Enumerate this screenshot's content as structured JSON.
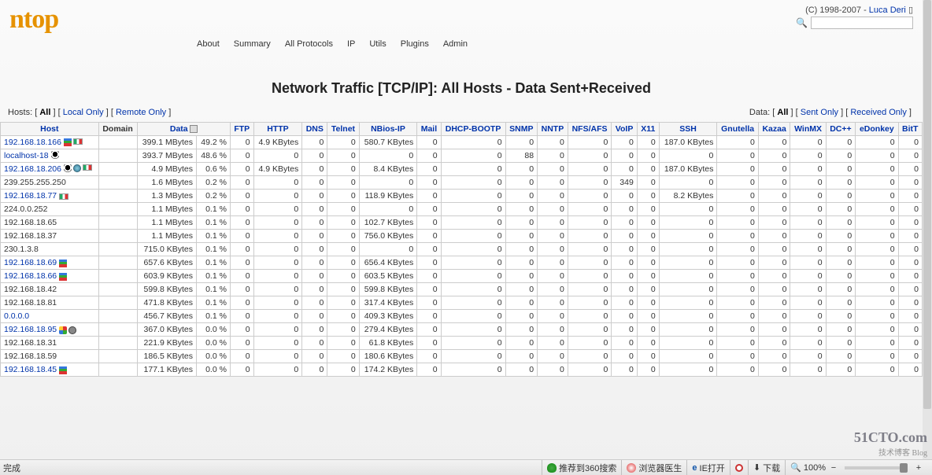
{
  "logo": "ntop",
  "copyright_prefix": "(C) 1998-2007 - ",
  "copyright_author": "Luca Deri",
  "search": {
    "placeholder": ""
  },
  "menu": [
    "About",
    "Summary",
    "All Protocols",
    "IP",
    "Utils",
    "Plugins",
    "Admin"
  ],
  "page_title": "Network Traffic [TCP/IP]: All Hosts - Data Sent+Received",
  "hosts_filter": {
    "label": "Hosts:",
    "all": "All",
    "local": "Local Only",
    "remote": "Remote Only"
  },
  "data_filter": {
    "label": "Data:",
    "all": "All",
    "sent": "Sent Only",
    "recv": "Received Only"
  },
  "columns": [
    "Host",
    "Domain",
    "Data",
    "FTP",
    "HTTP",
    "DNS",
    "Telnet",
    "NBios-IP",
    "Mail",
    "DHCP-BOOTP",
    "SNMP",
    "NNTP",
    "NFS/AFS",
    "VoIP",
    "X11",
    "SSH",
    "Gnutella",
    "Kazaa",
    "WinMX",
    "DC++",
    "eDonkey",
    "BitT"
  ],
  "rows": [
    {
      "host": "192.168.18.166",
      "link": true,
      "icons": [
        "chart",
        "flag"
      ],
      "domain": "",
      "data": "399.1 MBytes",
      "pct": "49.2 %",
      "ftp": "0",
      "http": "4.9 KBytes",
      "dns": "0",
      "telnet": "0",
      "nbios": "580.7 KBytes",
      "mail": "0",
      "dhcp": "0",
      "snmp": "0",
      "nntp": "0",
      "nfs": "0",
      "voip": "0",
      "x11": "0",
      "ssh": "187.0 KBytes",
      "gnut": "0",
      "kazaa": "0",
      "winmx": "0",
      "dcpp": "0",
      "edon": "0",
      "bitt": "0"
    },
    {
      "host": "localhost-18",
      "link": true,
      "icons": [
        "tux"
      ],
      "domain": "",
      "data": "393.7 MBytes",
      "pct": "48.6 %",
      "ftp": "0",
      "http": "0",
      "dns": "0",
      "telnet": "0",
      "nbios": "0",
      "mail": "0",
      "dhcp": "0",
      "snmp": "88",
      "nntp": "0",
      "nfs": "0",
      "voip": "0",
      "x11": "0",
      "ssh": "0",
      "gnut": "0",
      "kazaa": "0",
      "winmx": "0",
      "dcpp": "0",
      "edon": "0",
      "bitt": "0"
    },
    {
      "host": "192.168.18.206",
      "link": true,
      "icons": [
        "tux",
        "globe",
        "flag"
      ],
      "domain": "",
      "data": "4.9 MBytes",
      "pct": "0.6 %",
      "ftp": "0",
      "http": "4.9 KBytes",
      "dns": "0",
      "telnet": "0",
      "nbios": "8.4 KBytes",
      "mail": "0",
      "dhcp": "0",
      "snmp": "0",
      "nntp": "0",
      "nfs": "0",
      "voip": "0",
      "x11": "0",
      "ssh": "187.0 KBytes",
      "gnut": "0",
      "kazaa": "0",
      "winmx": "0",
      "dcpp": "0",
      "edon": "0",
      "bitt": "0"
    },
    {
      "host": "239.255.255.250",
      "link": false,
      "icons": [],
      "domain": "",
      "data": "1.6 MBytes",
      "pct": "0.2 %",
      "ftp": "0",
      "http": "0",
      "dns": "0",
      "telnet": "0",
      "nbios": "0",
      "mail": "0",
      "dhcp": "0",
      "snmp": "0",
      "nntp": "0",
      "nfs": "0",
      "voip": "349",
      "x11": "0",
      "ssh": "0",
      "gnut": "0",
      "kazaa": "0",
      "winmx": "0",
      "dcpp": "0",
      "edon": "0",
      "bitt": "0"
    },
    {
      "host": "192.168.18.77",
      "link": true,
      "icons": [
        "flag"
      ],
      "domain": "",
      "data": "1.3 MBytes",
      "pct": "0.2 %",
      "ftp": "0",
      "http": "0",
      "dns": "0",
      "telnet": "0",
      "nbios": "118.9 KBytes",
      "mail": "0",
      "dhcp": "0",
      "snmp": "0",
      "nntp": "0",
      "nfs": "0",
      "voip": "0",
      "x11": "0",
      "ssh": "8.2 KBytes",
      "gnut": "0",
      "kazaa": "0",
      "winmx": "0",
      "dcpp": "0",
      "edon": "0",
      "bitt": "0"
    },
    {
      "host": "224.0.0.252",
      "link": false,
      "icons": [],
      "domain": "",
      "data": "1.1 MBytes",
      "pct": "0.1 %",
      "ftp": "0",
      "http": "0",
      "dns": "0",
      "telnet": "0",
      "nbios": "0",
      "mail": "0",
      "dhcp": "0",
      "snmp": "0",
      "nntp": "0",
      "nfs": "0",
      "voip": "0",
      "x11": "0",
      "ssh": "0",
      "gnut": "0",
      "kazaa": "0",
      "winmx": "0",
      "dcpp": "0",
      "edon": "0",
      "bitt": "0"
    },
    {
      "host": "192.168.18.65",
      "link": false,
      "icons": [],
      "domain": "",
      "data": "1.1 MBytes",
      "pct": "0.1 %",
      "ftp": "0",
      "http": "0",
      "dns": "0",
      "telnet": "0",
      "nbios": "102.7 KBytes",
      "mail": "0",
      "dhcp": "0",
      "snmp": "0",
      "nntp": "0",
      "nfs": "0",
      "voip": "0",
      "x11": "0",
      "ssh": "0",
      "gnut": "0",
      "kazaa": "0",
      "winmx": "0",
      "dcpp": "0",
      "edon": "0",
      "bitt": "0"
    },
    {
      "host": "192.168.18.37",
      "link": false,
      "icons": [],
      "domain": "",
      "data": "1.1 MBytes",
      "pct": "0.1 %",
      "ftp": "0",
      "http": "0",
      "dns": "0",
      "telnet": "0",
      "nbios": "756.0 KBytes",
      "mail": "0",
      "dhcp": "0",
      "snmp": "0",
      "nntp": "0",
      "nfs": "0",
      "voip": "0",
      "x11": "0",
      "ssh": "0",
      "gnut": "0",
      "kazaa": "0",
      "winmx": "0",
      "dcpp": "0",
      "edon": "0",
      "bitt": "0"
    },
    {
      "host": "230.1.3.8",
      "link": false,
      "icons": [],
      "domain": "",
      "data": "715.0 KBytes",
      "pct": "0.1 %",
      "ftp": "0",
      "http": "0",
      "dns": "0",
      "telnet": "0",
      "nbios": "0",
      "mail": "0",
      "dhcp": "0",
      "snmp": "0",
      "nntp": "0",
      "nfs": "0",
      "voip": "0",
      "x11": "0",
      "ssh": "0",
      "gnut": "0",
      "kazaa": "0",
      "winmx": "0",
      "dcpp": "0",
      "edon": "0",
      "bitt": "0"
    },
    {
      "host": "192.168.18.69",
      "link": true,
      "icons": [
        "chart"
      ],
      "domain": "",
      "data": "657.6 KBytes",
      "pct": "0.1 %",
      "ftp": "0",
      "http": "0",
      "dns": "0",
      "telnet": "0",
      "nbios": "656.4 KBytes",
      "mail": "0",
      "dhcp": "0",
      "snmp": "0",
      "nntp": "0",
      "nfs": "0",
      "voip": "0",
      "x11": "0",
      "ssh": "0",
      "gnut": "0",
      "kazaa": "0",
      "winmx": "0",
      "dcpp": "0",
      "edon": "0",
      "bitt": "0"
    },
    {
      "host": "192.168.18.66",
      "link": true,
      "icons": [
        "chart"
      ],
      "domain": "",
      "data": "603.9 KBytes",
      "pct": "0.1 %",
      "ftp": "0",
      "http": "0",
      "dns": "0",
      "telnet": "0",
      "nbios": "603.5 KBytes",
      "mail": "0",
      "dhcp": "0",
      "snmp": "0",
      "nntp": "0",
      "nfs": "0",
      "voip": "0",
      "x11": "0",
      "ssh": "0",
      "gnut": "0",
      "kazaa": "0",
      "winmx": "0",
      "dcpp": "0",
      "edon": "0",
      "bitt": "0"
    },
    {
      "host": "192.168.18.42",
      "link": false,
      "icons": [],
      "domain": "",
      "data": "599.8 KBytes",
      "pct": "0.1 %",
      "ftp": "0",
      "http": "0",
      "dns": "0",
      "telnet": "0",
      "nbios": "599.8 KBytes",
      "mail": "0",
      "dhcp": "0",
      "snmp": "0",
      "nntp": "0",
      "nfs": "0",
      "voip": "0",
      "x11": "0",
      "ssh": "0",
      "gnut": "0",
      "kazaa": "0",
      "winmx": "0",
      "dcpp": "0",
      "edon": "0",
      "bitt": "0"
    },
    {
      "host": "192.168.18.81",
      "link": false,
      "icons": [],
      "domain": "",
      "data": "471.8 KBytes",
      "pct": "0.1 %",
      "ftp": "0",
      "http": "0",
      "dns": "0",
      "telnet": "0",
      "nbios": "317.4 KBytes",
      "mail": "0",
      "dhcp": "0",
      "snmp": "0",
      "nntp": "0",
      "nfs": "0",
      "voip": "0",
      "x11": "0",
      "ssh": "0",
      "gnut": "0",
      "kazaa": "0",
      "winmx": "0",
      "dcpp": "0",
      "edon": "0",
      "bitt": "0"
    },
    {
      "host": "0.0.0.0",
      "link": true,
      "icons": [],
      "domain": "",
      "data": "456.7 KBytes",
      "pct": "0.1 %",
      "ftp": "0",
      "http": "0",
      "dns": "0",
      "telnet": "0",
      "nbios": "409.3 KBytes",
      "mail": "0",
      "dhcp": "0",
      "snmp": "0",
      "nntp": "0",
      "nfs": "0",
      "voip": "0",
      "x11": "0",
      "ssh": "0",
      "gnut": "0",
      "kazaa": "0",
      "winmx": "0",
      "dcpp": "0",
      "edon": "0",
      "bitt": "0"
    },
    {
      "host": "192.168.18.95",
      "link": true,
      "icons": [
        "win",
        "p2p"
      ],
      "domain": "",
      "data": "367.0 KBytes",
      "pct": "0.0 %",
      "ftp": "0",
      "http": "0",
      "dns": "0",
      "telnet": "0",
      "nbios": "279.4 KBytes",
      "mail": "0",
      "dhcp": "0",
      "snmp": "0",
      "nntp": "0",
      "nfs": "0",
      "voip": "0",
      "x11": "0",
      "ssh": "0",
      "gnut": "0",
      "kazaa": "0",
      "winmx": "0",
      "dcpp": "0",
      "edon": "0",
      "bitt": "0"
    },
    {
      "host": "192.168.18.31",
      "link": false,
      "icons": [],
      "domain": "",
      "data": "221.9 KBytes",
      "pct": "0.0 %",
      "ftp": "0",
      "http": "0",
      "dns": "0",
      "telnet": "0",
      "nbios": "61.8 KBytes",
      "mail": "0",
      "dhcp": "0",
      "snmp": "0",
      "nntp": "0",
      "nfs": "0",
      "voip": "0",
      "x11": "0",
      "ssh": "0",
      "gnut": "0",
      "kazaa": "0",
      "winmx": "0",
      "dcpp": "0",
      "edon": "0",
      "bitt": "0"
    },
    {
      "host": "192.168.18.59",
      "link": false,
      "icons": [],
      "domain": "",
      "data": "186.5 KBytes",
      "pct": "0.0 %",
      "ftp": "0",
      "http": "0",
      "dns": "0",
      "telnet": "0",
      "nbios": "180.6 KBytes",
      "mail": "0",
      "dhcp": "0",
      "snmp": "0",
      "nntp": "0",
      "nfs": "0",
      "voip": "0",
      "x11": "0",
      "ssh": "0",
      "gnut": "0",
      "kazaa": "0",
      "winmx": "0",
      "dcpp": "0",
      "edon": "0",
      "bitt": "0"
    },
    {
      "host": "192.168.18.45",
      "link": true,
      "icons": [
        "chart"
      ],
      "domain": "",
      "data": "177.1 KBytes",
      "pct": "0.0 %",
      "ftp": "0",
      "http": "0",
      "dns": "0",
      "telnet": "0",
      "nbios": "174.2 KBytes",
      "mail": "0",
      "dhcp": "0",
      "snmp": "0",
      "nntp": "0",
      "nfs": "0",
      "voip": "0",
      "x11": "0",
      "ssh": "0",
      "gnut": "0",
      "kazaa": "0",
      "winmx": "0",
      "dcpp": "0",
      "edon": "0",
      "bitt": "0"
    }
  ],
  "statusbar": {
    "done": "完成",
    "recommend": "推荐到360搜索",
    "doctor": "浏览器医生",
    "open_ie": "IE打开",
    "download": "下载",
    "zoom": "100%"
  },
  "watermark": {
    "big": "51CTO.com",
    "small": "技术博客  Blog"
  }
}
